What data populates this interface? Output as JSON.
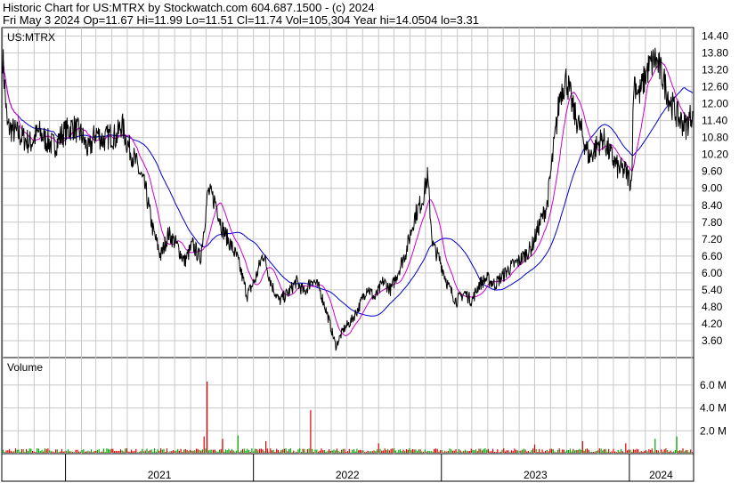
{
  "header": {
    "line1": "Historic Chart for US:MTRX by Stockwatch.com 604.687.1500 - (c) 2024",
    "line2": "Fri May  3 2024  Op=11.67  Hi=11.99  Lo=11.51  Cl=11.74  Vol=105,304  Year hi=14.0504  lo=3.31"
  },
  "chart_data": {
    "type": "line",
    "symbol": "US:MTRX",
    "price_ticks": [
      "14.40",
      "13.80",
      "13.20",
      "12.60",
      "12.00",
      "11.40",
      "10.80",
      "10.20",
      "9.60",
      "9.00",
      "8.40",
      "7.80",
      "7.20",
      "6.60",
      "6.00",
      "5.40",
      "4.80",
      "4.20",
      "3.60"
    ],
    "ylim": [
      3.0,
      14.7
    ],
    "volume_label": "Volume",
    "volume_ticks": [
      "6.0 M",
      "4.0 M",
      "2.0 M"
    ],
    "volume_ylim": [
      0,
      8.4
    ],
    "year_labels": [
      "2021",
      "2022",
      "2023",
      "2024"
    ],
    "xlim": [
      "2020-09-01",
      "2024-05-03"
    ],
    "price_points": [
      [
        "2020-09-01",
        13.7
      ],
      [
        "2020-09-10",
        11.2
      ],
      [
        "2020-09-25",
        11.0
      ],
      [
        "2020-10-10",
        10.8
      ],
      [
        "2020-10-25",
        10.6
      ],
      [
        "2020-11-10",
        11.0
      ],
      [
        "2020-11-25",
        10.7
      ],
      [
        "2020-12-10",
        10.5
      ],
      [
        "2020-12-25",
        10.9
      ],
      [
        "2021-01-15",
        11.2
      ],
      [
        "2021-02-01",
        10.9
      ],
      [
        "2021-02-15",
        10.3
      ],
      [
        "2021-03-01",
        11.0
      ],
      [
        "2021-03-15",
        10.7
      ],
      [
        "2021-03-30",
        10.9
      ],
      [
        "2021-04-10",
        10.8
      ],
      [
        "2021-04-20",
        11.3
      ],
      [
        "2021-05-01",
        10.6
      ],
      [
        "2021-05-20",
        9.8
      ],
      [
        "2021-06-05",
        9.0
      ],
      [
        "2021-06-20",
        7.5
      ],
      [
        "2021-07-05",
        6.6
      ],
      [
        "2021-07-20",
        7.4
      ],
      [
        "2021-08-05",
        7.0
      ],
      [
        "2021-08-20",
        6.4
      ],
      [
        "2021-09-05",
        7.0
      ],
      [
        "2021-09-20",
        6.5
      ],
      [
        "2021-10-05",
        8.9
      ],
      [
        "2021-10-20",
        8.5
      ],
      [
        "2021-11-01",
        7.6
      ],
      [
        "2021-11-15",
        7.1
      ],
      [
        "2021-12-01",
        6.5
      ],
      [
        "2021-12-20",
        5.2
      ],
      [
        "2022-01-05",
        5.8
      ],
      [
        "2022-01-20",
        6.7
      ],
      [
        "2022-02-05",
        5.6
      ],
      [
        "2022-02-20",
        5.0
      ],
      [
        "2022-03-10",
        5.3
      ],
      [
        "2022-03-25",
        5.7
      ],
      [
        "2022-04-10",
        5.3
      ],
      [
        "2022-04-25",
        5.8
      ],
      [
        "2022-05-10",
        5.4
      ],
      [
        "2022-05-25",
        4.5
      ],
      [
        "2022-06-10",
        3.4
      ],
      [
        "2022-06-25",
        4.0
      ],
      [
        "2022-07-10",
        4.3
      ],
      [
        "2022-07-25",
        4.8
      ],
      [
        "2022-08-10",
        5.5
      ],
      [
        "2022-08-25",
        5.1
      ],
      [
        "2022-09-10",
        5.7
      ],
      [
        "2022-09-25",
        5.4
      ],
      [
        "2022-10-10",
        6.1
      ],
      [
        "2022-10-25",
        6.8
      ],
      [
        "2022-11-10",
        8.0
      ],
      [
        "2022-11-25",
        8.6
      ],
      [
        "2022-12-05",
        9.4
      ],
      [
        "2022-12-15",
        7.0
      ],
      [
        "2022-12-30",
        6.4
      ],
      [
        "2023-01-15",
        5.5
      ],
      [
        "2023-01-30",
        5.0
      ],
      [
        "2023-02-15",
        5.3
      ],
      [
        "2023-03-01",
        5.0
      ],
      [
        "2023-03-15",
        5.6
      ],
      [
        "2023-03-30",
        5.8
      ],
      [
        "2023-04-15",
        5.6
      ],
      [
        "2023-04-30",
        5.9
      ],
      [
        "2023-05-15",
        6.2
      ],
      [
        "2023-05-30",
        6.4
      ],
      [
        "2023-06-10",
        6.6
      ],
      [
        "2023-06-25",
        6.9
      ],
      [
        "2023-07-10",
        7.7
      ],
      [
        "2023-07-25",
        8.4
      ],
      [
        "2023-08-05",
        10.1
      ],
      [
        "2023-08-20",
        12.4
      ],
      [
        "2023-09-01",
        12.9
      ],
      [
        "2023-09-15",
        11.7
      ],
      [
        "2023-09-30",
        11.0
      ],
      [
        "2023-10-15",
        10.1
      ],
      [
        "2023-10-30",
        10.5
      ],
      [
        "2023-11-10",
        10.8
      ],
      [
        "2023-11-25",
        10.2
      ],
      [
        "2023-12-10",
        9.7
      ],
      [
        "2023-12-25",
        9.6
      ],
      [
        "2024-01-05",
        9.2
      ],
      [
        "2024-01-10",
        12.9
      ],
      [
        "2024-01-20",
        12.3
      ],
      [
        "2024-02-05",
        13.2
      ],
      [
        "2024-02-20",
        13.6
      ],
      [
        "2024-03-05",
        13.0
      ],
      [
        "2024-03-20",
        12.1
      ],
      [
        "2024-04-05",
        11.5
      ],
      [
        "2024-04-20",
        11.2
      ],
      [
        "2024-05-03",
        11.74
      ]
    ],
    "series": [
      {
        "color": "#000000",
        "role": "price"
      },
      {
        "color": "#cc00cc",
        "role": "short-moving-average"
      },
      {
        "color": "#0000cc",
        "role": "long-moving-average"
      }
    ],
    "volume_spikes": [
      [
        "2021-10-01",
        6.3
      ],
      [
        "2021-09-25",
        1.5
      ],
      [
        "2021-11-01",
        1.3
      ],
      [
        "2021-12-01",
        1.6
      ],
      [
        "2022-01-25",
        1.1
      ],
      [
        "2022-04-20",
        3.8
      ],
      [
        "2022-09-01",
        0.9
      ],
      [
        "2023-10-01",
        1.1
      ],
      [
        "2024-02-20",
        1.3
      ],
      [
        "2024-04-01",
        1.5
      ],
      [
        "2023-12-25",
        0.9
      ],
      [
        "2023-07-01",
        0.8
      ]
    ],
    "colors": {
      "price": "#000000",
      "ma_short": "#cc00cc",
      "ma_long": "#0000cc",
      "vol_up": "#00aa00",
      "vol_down": "#dd0000",
      "grid": "#c8c8c8"
    }
  }
}
